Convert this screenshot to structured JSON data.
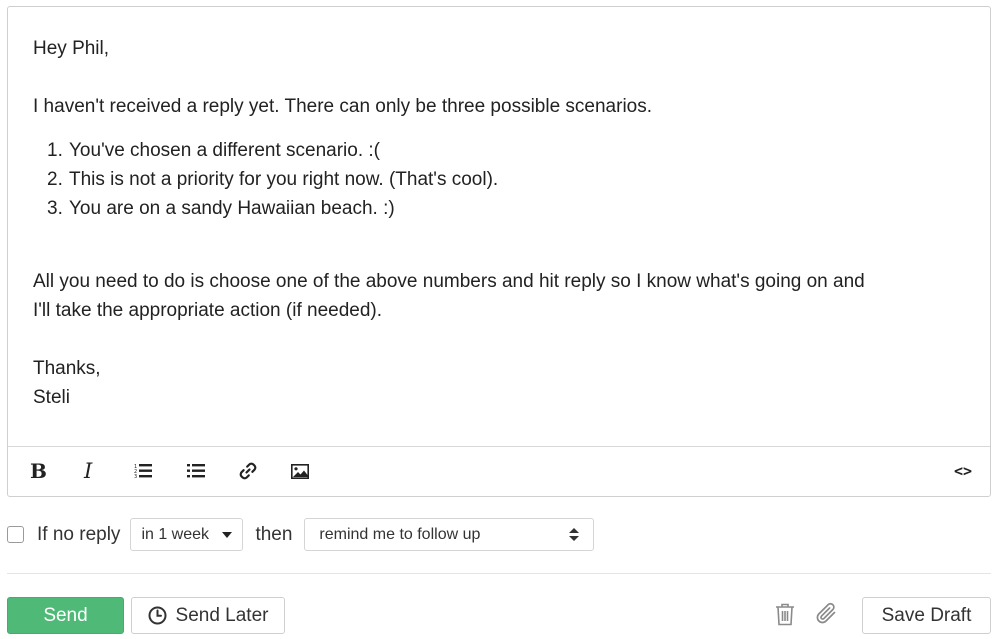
{
  "email": {
    "greeting": "Hey Phil,",
    "intro": "I haven't received a reply yet. There can only be three possible scenarios.",
    "scenarios": [
      {
        "num": "1.",
        "text": "You've chosen a different scenario. :("
      },
      {
        "num": "2.",
        "text": "This is not a priority for you right now. (That's cool)."
      },
      {
        "num": "3.",
        "text": "You are on a sandy Hawaiian beach. :)"
      }
    ],
    "action_line1": "All you need to do is choose one of the above numbers and hit reply so I know what's going on and",
    "action_line2": "I'll take the appropriate action (if needed).",
    "signoff": "Thanks,",
    "signature": "Steli"
  },
  "toolbar": {
    "bold": "B",
    "italic": "I",
    "code": "<>",
    "icons": [
      "bold-icon",
      "italic-icon",
      "ordered-list-icon",
      "unordered-list-icon",
      "link-icon",
      "image-icon",
      "code-icon"
    ]
  },
  "followup": {
    "checkbox_checked": false,
    "if_no_reply_label": "If no reply",
    "delay_value": "in 1 week",
    "then_label": "then",
    "action_value": "remind me to follow up"
  },
  "footer": {
    "send_label": "Send",
    "send_later_label": "Send Later",
    "save_draft_label": "Save Draft",
    "send_color": "#4fba78"
  }
}
